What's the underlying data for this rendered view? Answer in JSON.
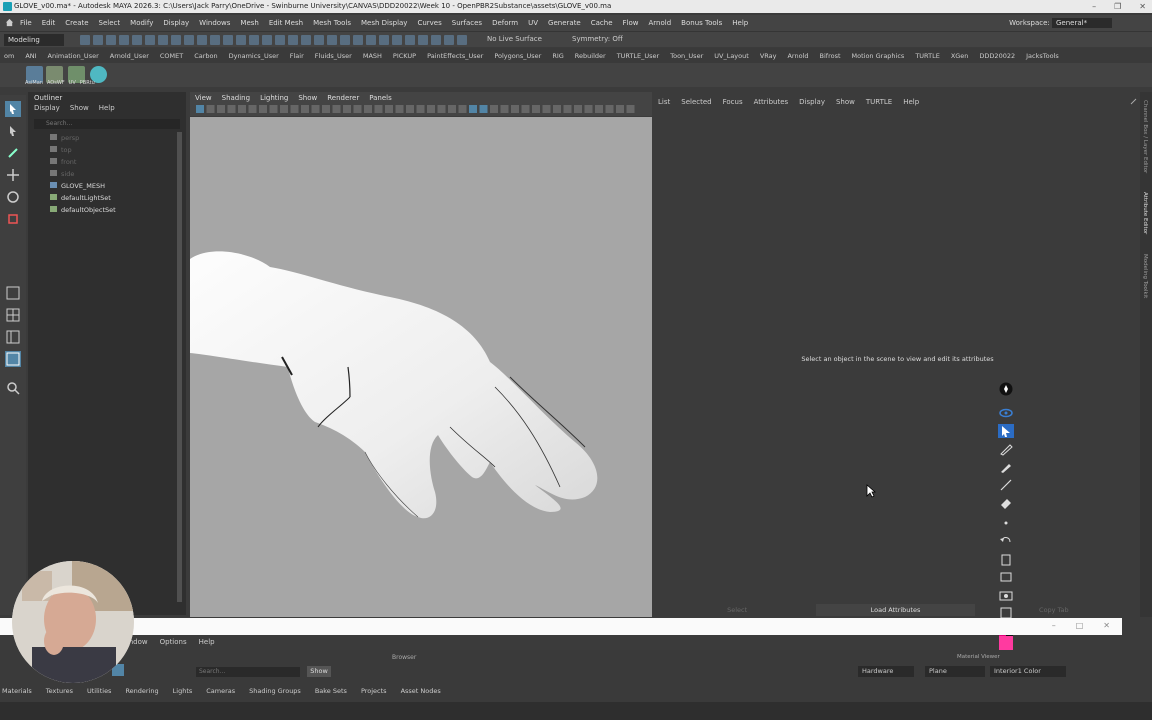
{
  "window": {
    "title": "GLOVE_v00.ma* - Autodesk MAYA 2026.3: C:\\Users\\Jack Parry\\OneDrive - Swinburne University\\CANVAS\\DDD20022\\Week 10 - OpenPBR2Substance\\assets\\GLOVE_v00.ma"
  },
  "menubar": {
    "items": [
      "File",
      "Edit",
      "Create",
      "Select",
      "Modify",
      "Display",
      "Windows",
      "Mesh",
      "Edit Mesh",
      "Mesh Tools",
      "Mesh Display",
      "Curves",
      "Surfaces",
      "Deform",
      "UV",
      "Generate",
      "Cache",
      "Flow",
      "Arnold",
      "Bonus Tools",
      "Help"
    ],
    "workspace_label": "Workspace:",
    "workspace_value": "General*"
  },
  "statusline": {
    "mode": "Modeling",
    "live_surface": "No Live Surface",
    "symmetry": "Symmetry: Off"
  },
  "shelf": {
    "tabs": [
      "om",
      "ANI",
      "Animation_User",
      "Arnold_User",
      "COMET",
      "Carbon",
      "Dynamics_User",
      "Flair",
      "Fluids_User",
      "MASH",
      "PICKUP",
      "PaintEffects_User",
      "Polygons_User",
      "RIG",
      "Rebuilder",
      "TURTLE_User",
      "Toon_User",
      "UV_Layout",
      "VRay",
      "Arnold",
      "Bifrost",
      "Motion Graphics",
      "TURTLE",
      "XGen",
      "DDD20022",
      "JacksTools"
    ],
    "icon_labels": [
      "AsiMan",
      "AOsWF",
      "UV",
      "PBRtu"
    ]
  },
  "outliner": {
    "title": "Outliner",
    "menu": [
      "Display",
      "Show",
      "Help"
    ],
    "search_placeholder": "Search...",
    "items": [
      {
        "label": "persp",
        "dim": true
      },
      {
        "label": "top",
        "dim": true
      },
      {
        "label": "front",
        "dim": true
      },
      {
        "label": "side",
        "dim": true
      },
      {
        "label": "GLOVE_MESH",
        "dim": false
      },
      {
        "label": "defaultLightSet",
        "dim": false
      },
      {
        "label": "defaultObjectSet",
        "dim": false
      }
    ]
  },
  "viewport": {
    "menu": [
      "View",
      "Shading",
      "Lighting",
      "Show",
      "Renderer",
      "Panels"
    ]
  },
  "attribute_editor": {
    "menu": [
      "List",
      "Selected",
      "Focus",
      "Attributes",
      "Display",
      "Show",
      "TURTLE",
      "Help"
    ],
    "message": "Select an object in the scene to view and edit its attributes",
    "bottom_buttons": [
      "Select",
      "Load Attributes",
      "Copy Tab"
    ],
    "side_tabs": [
      "Channel Box / Layer Editor",
      "Attribute Editor",
      "Modeling Toolkit"
    ]
  },
  "hypershade": {
    "menu": [
      "Window",
      "Options",
      "Help"
    ],
    "browser_label": "Browser",
    "material_viewer_label": "Material Viewer",
    "search_placeholder": "Search...",
    "show_button": "Show",
    "renderer": "Hardware",
    "geometry": "Plane",
    "color_mode": "Interior1 Color",
    "tabs": [
      "Materials",
      "Textures",
      "Utilities",
      "Rendering",
      "Lights",
      "Cameras",
      "Shading Groups",
      "Bake Sets",
      "Projects",
      "Asset Nodes"
    ]
  },
  "colors": {
    "accent": "#5285a6",
    "viewport_bg": "#a6a6a6",
    "panel_bg": "#3b3b3b"
  }
}
